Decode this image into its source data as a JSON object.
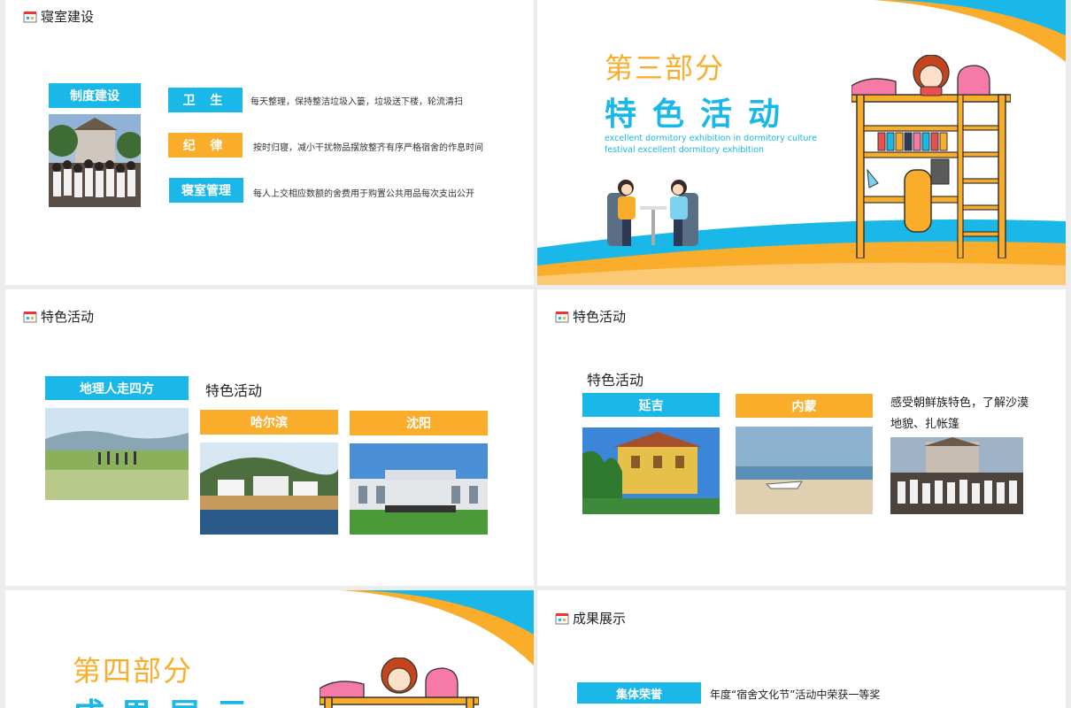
{
  "slides": {
    "s1": {
      "header": "寝室建设",
      "left_tag": "制度建设",
      "rows": [
        {
          "tag": "卫 生",
          "text": "每天整理，保持整洁垃圾入篓，垃圾送下楼，轮流清扫"
        },
        {
          "tag": "纪 律",
          "text": "按时归寝，减小干扰物品摆放整齐有序严格宿舍的作息时间"
        },
        {
          "tag": "寝室管理",
          "text": "每人上交相应数额的舍费用于购置公共用品每次支出公开"
        }
      ]
    },
    "s2": {
      "part": "第三部分",
      "title": "特色活动",
      "en_line1": "excellent dormitory exhibition in dormitory culture",
      "en_line2": "festival excellent dormitory exhibition"
    },
    "s3": {
      "header": "特色活动",
      "tag1": "地理人走四方",
      "label": "特色活动",
      "tag2": "哈尔滨",
      "tag3": "沈阳"
    },
    "s4": {
      "header": "特色活动",
      "label": "特色活动",
      "tag1": "延吉",
      "tag2": "内蒙",
      "desc": "感受朝鲜族特色，了解沙漠地貌、扎帐篷"
    },
    "s5": {
      "part": "第四部分",
      "title": "成果展示"
    },
    "s6": {
      "header": "成果展示",
      "tag": "集体荣誉",
      "text": "年度“宿舍文化节”活动中荣获一等奖"
    }
  },
  "colors": {
    "blue": "#19b8e8",
    "orange": "#f9ad2b"
  }
}
